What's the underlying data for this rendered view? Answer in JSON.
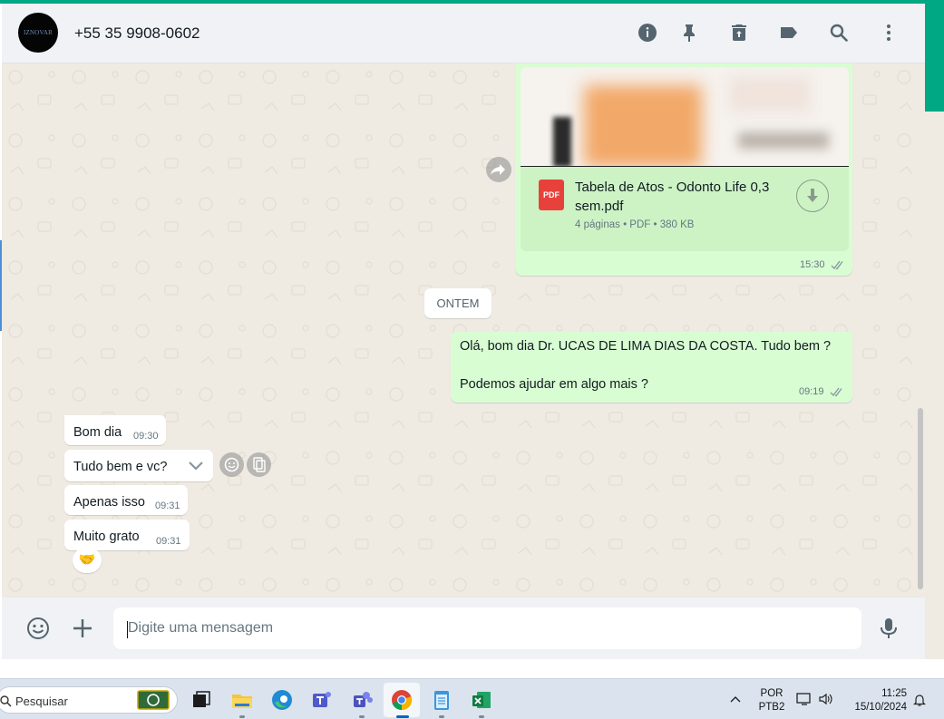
{
  "header": {
    "avatar_text": "IZNOVAR",
    "contact_name": "+55 35 9908-0602",
    "icons": [
      "info-icon",
      "pin-icon",
      "delete-icon",
      "label-icon",
      "search-icon",
      "menu-icon"
    ]
  },
  "messages": {
    "document": {
      "file_name": "Tabela de Atos - Odonto Life 0,3 sem.pdf",
      "file_type_badge": "PDF",
      "meta": "4 páginas • PDF • 380 KB",
      "time": "15:30"
    },
    "day_separator": "ONTEM",
    "outgoing_text": {
      "line1": "Olá, bom dia Dr. UCAS DE LIMA DIAS DA COSTA. Tudo bem ?",
      "line2": "Podemos ajudar em algo mais ?",
      "time": "09:19"
    },
    "incoming": [
      {
        "text": "Bom dia",
        "time": "09:30"
      },
      {
        "text": "Tudo bem e vc?",
        "time": ""
      },
      {
        "text": "Apenas isso",
        "time": "09:31"
      },
      {
        "text": "Muito grato",
        "time": "09:31"
      }
    ],
    "reaction": "🤝"
  },
  "composer": {
    "placeholder": "Digite uma mensagem"
  },
  "taskbar": {
    "search_label": "Pesquisar",
    "language_line1": "POR",
    "language_line2": "PTB2",
    "time": "11:25",
    "date": "15/10/2024"
  },
  "colors": {
    "accent": "#00a884",
    "outgoing_bubble": "#d9fdd3",
    "chat_background": "#efeae2",
    "read_ticks": "#53bdeb"
  }
}
